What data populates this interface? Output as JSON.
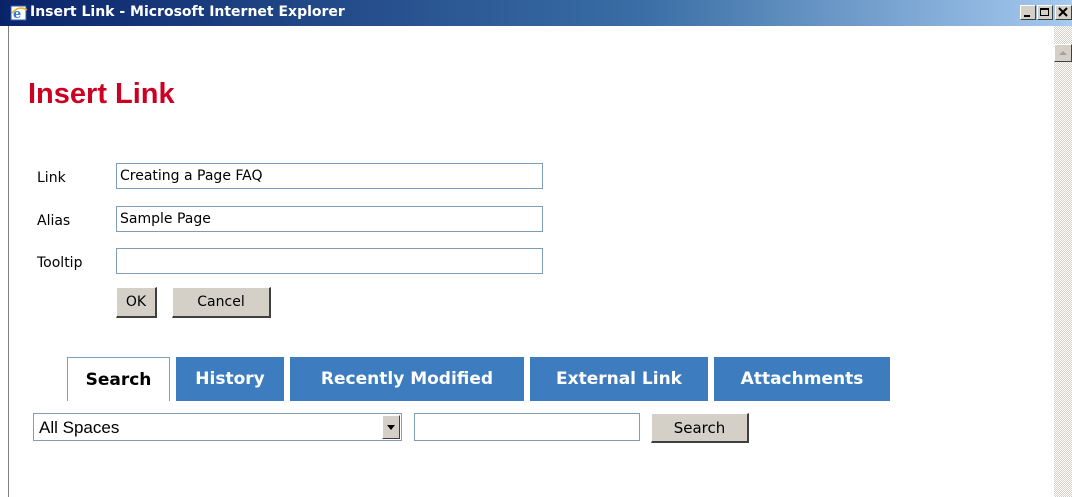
{
  "window": {
    "title": "Insert Link - Microsoft Internet Explorer",
    "icon": "ie-icon",
    "controls": [
      "minimize-icon",
      "maximize-icon",
      "close-icon"
    ]
  },
  "page": {
    "heading": "Insert Link",
    "heading_color": "#cc0022"
  },
  "form": {
    "link_label": "Link",
    "link_value": "Creating a Page FAQ",
    "alias_label": "Alias",
    "alias_value": "Sample Page",
    "tooltip_label": "Tooltip",
    "tooltip_value": "",
    "ok_label": "OK",
    "cancel_label": "Cancel"
  },
  "tabs": [
    {
      "label": "Search",
      "active": true
    },
    {
      "label": "History",
      "active": false
    },
    {
      "label": "Recently Modified",
      "active": false
    },
    {
      "label": "External Link",
      "active": false
    },
    {
      "label": "Attachments",
      "active": false
    }
  ],
  "tab_color": "#3d7dbf",
  "search": {
    "space_selected": "All Spaces",
    "query_value": "",
    "button_label": "Search"
  }
}
